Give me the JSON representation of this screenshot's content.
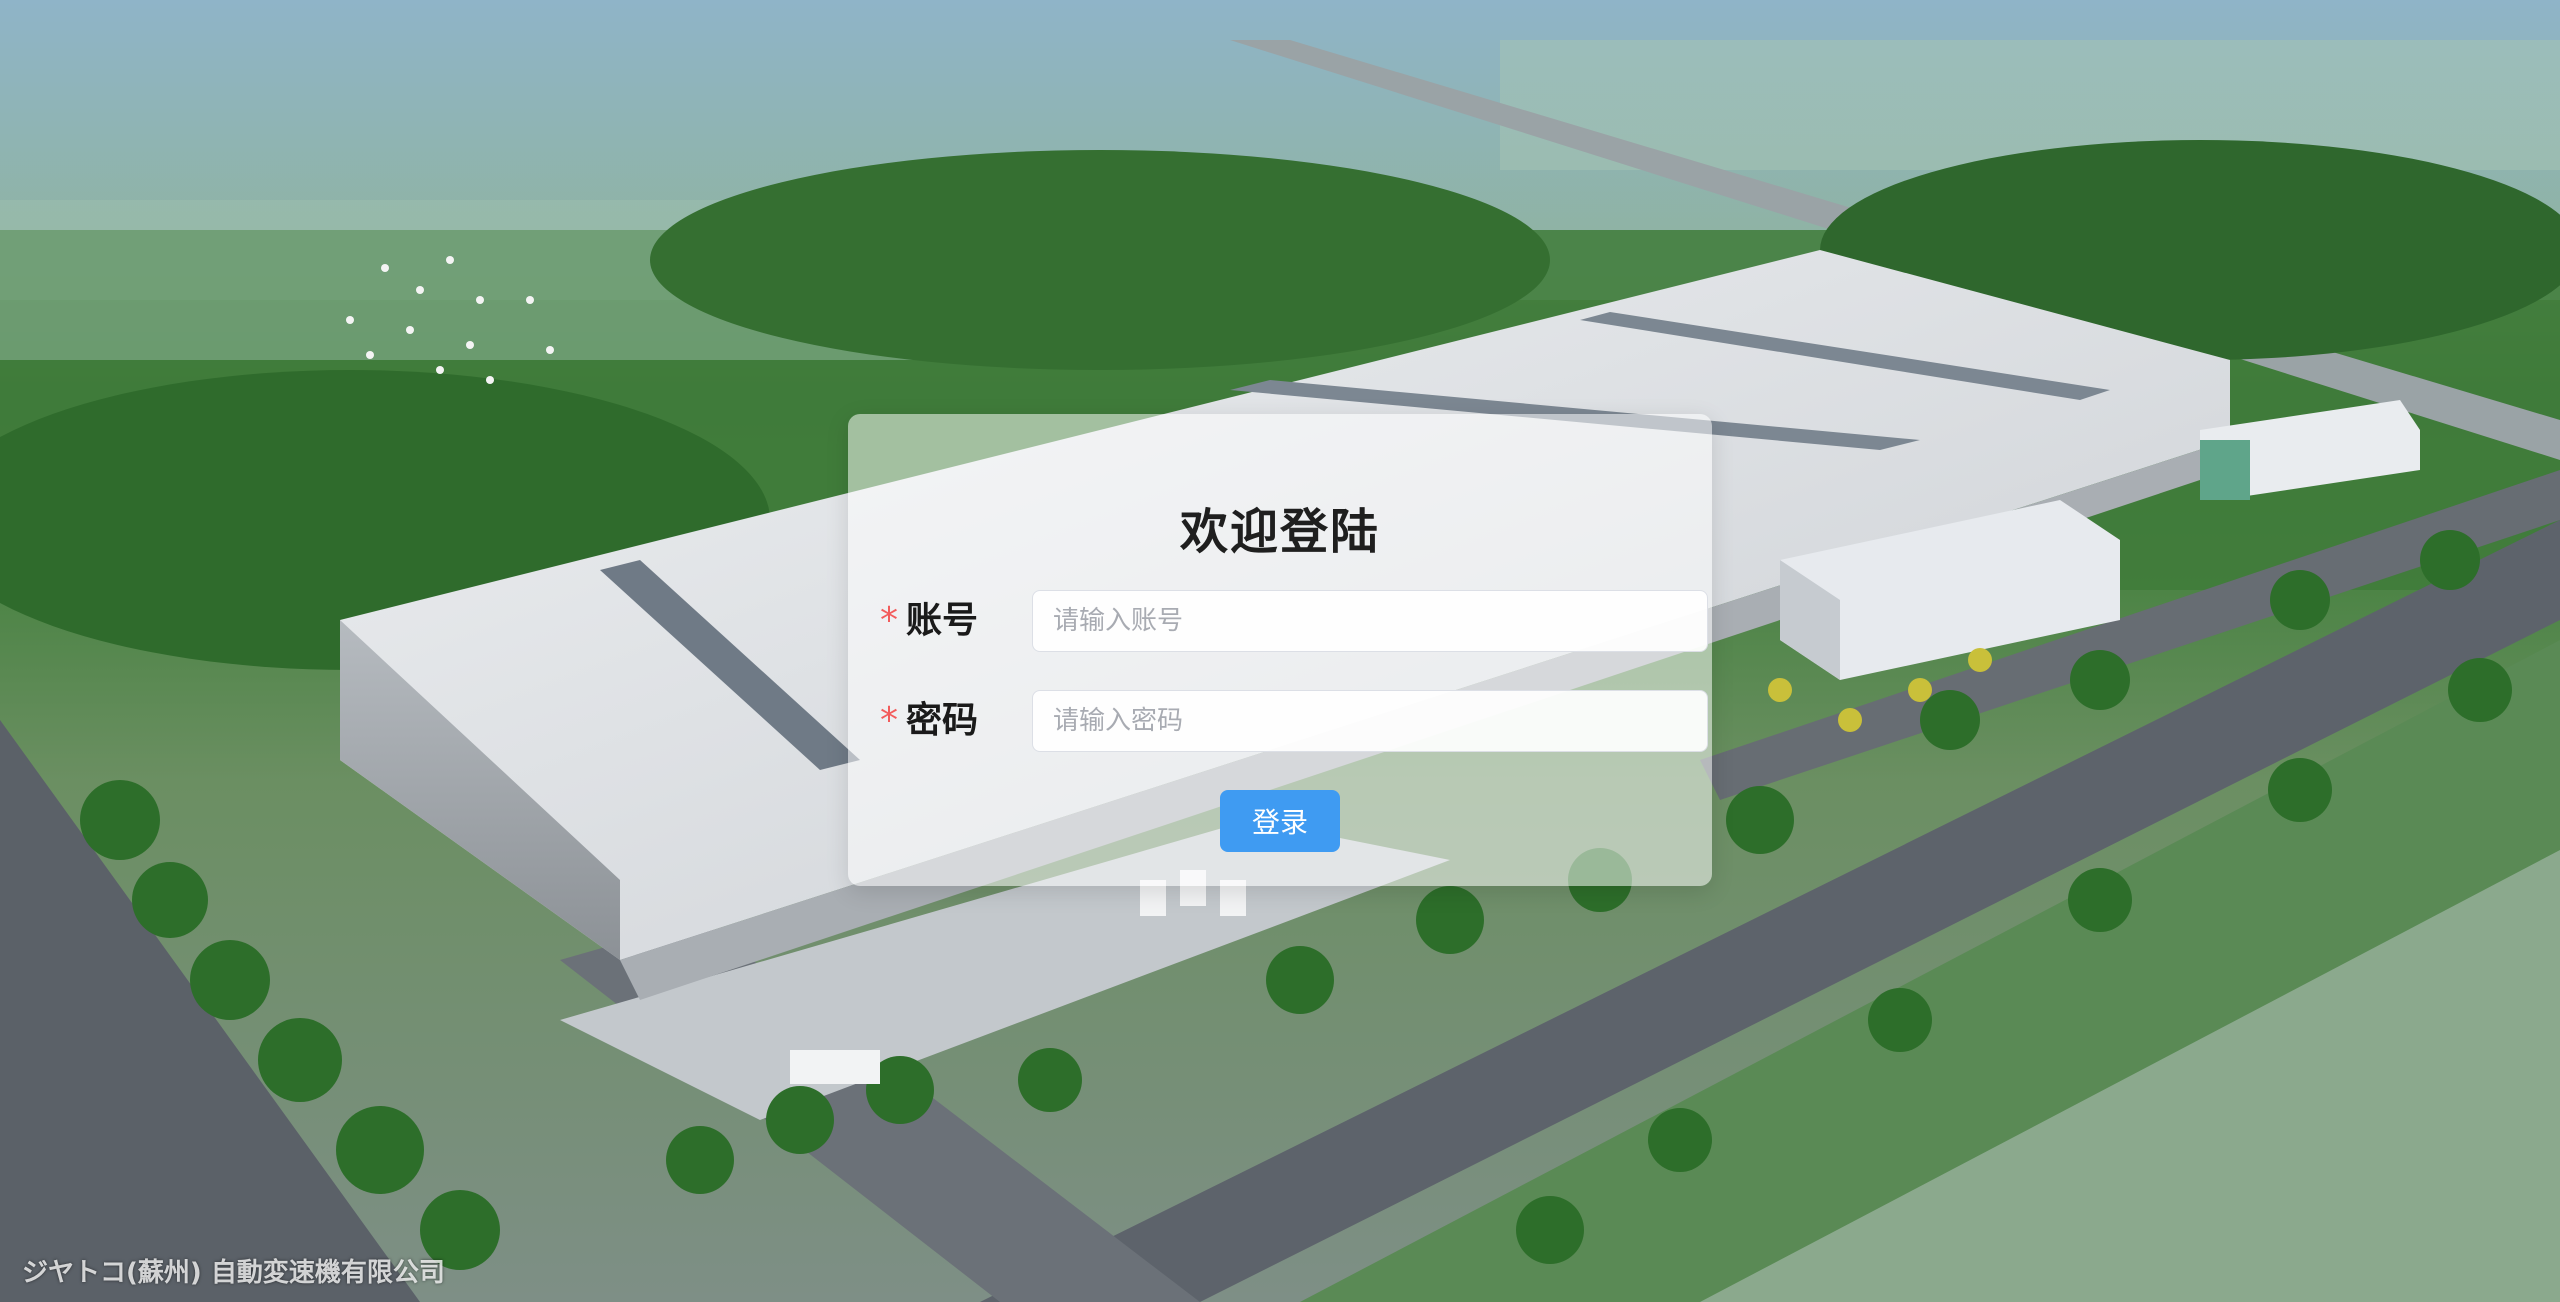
{
  "login": {
    "title": "欢迎登陆",
    "account_label": "账号",
    "account_placeholder": "请输入账号",
    "account_value": "",
    "password_label": "密码",
    "password_placeholder": "请输入密码",
    "password_value": "",
    "required_mark": "*",
    "submit_label": "登录"
  },
  "background": {
    "watermark": "ジヤトコ(蘇州) 自動変速機有限公司"
  },
  "colors": {
    "primary_button": "#3f9bf2",
    "required_mark": "#f25c5c",
    "card_background": "rgba(255,255,255,0.52)"
  }
}
